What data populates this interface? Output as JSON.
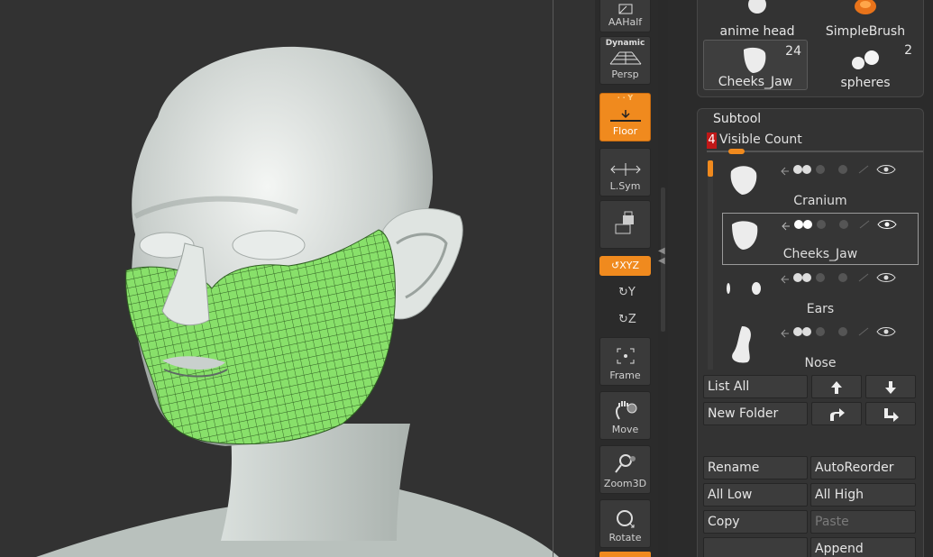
{
  "viewport": {
    "model": "head with subtool Cheeks_Jaw highlighted"
  },
  "shelf": {
    "aahalf": "AAHalf",
    "persp_top": "Dynamic",
    "persp": "Persp",
    "floor": "Floor",
    "lsym": "L.Sym",
    "xyz": "↺XYZ",
    "rot_y": "↻Y",
    "rot_z": "↻Z",
    "frame": "Frame",
    "move": "Move",
    "zoom3d": "Zoom3D",
    "rotate": "Rotate",
    "accent_color": "#f08a1e"
  },
  "tools": [
    {
      "name": "anime head",
      "count": ""
    },
    {
      "name": "SimpleBrush",
      "count": ""
    },
    {
      "name": "Cheeks_Jaw",
      "count": "24"
    },
    {
      "name": "spheres",
      "count": "2"
    }
  ],
  "subtool": {
    "title": "Subtool",
    "visible_count_value": "4",
    "visible_count_label": "Visible Count",
    "items": [
      {
        "name": "Cranium"
      },
      {
        "name": "Cheeks_Jaw"
      },
      {
        "name": "Ears"
      },
      {
        "name": "Nose"
      }
    ],
    "selected_index": 1
  },
  "buttons": {
    "list_all": "List All",
    "new_folder": "New Folder",
    "rename": "Rename",
    "auto_reorder": "AutoReorder",
    "all_low": "All Low",
    "all_high": "All High",
    "copy": "Copy",
    "paste": "Paste",
    "append": "Append"
  }
}
